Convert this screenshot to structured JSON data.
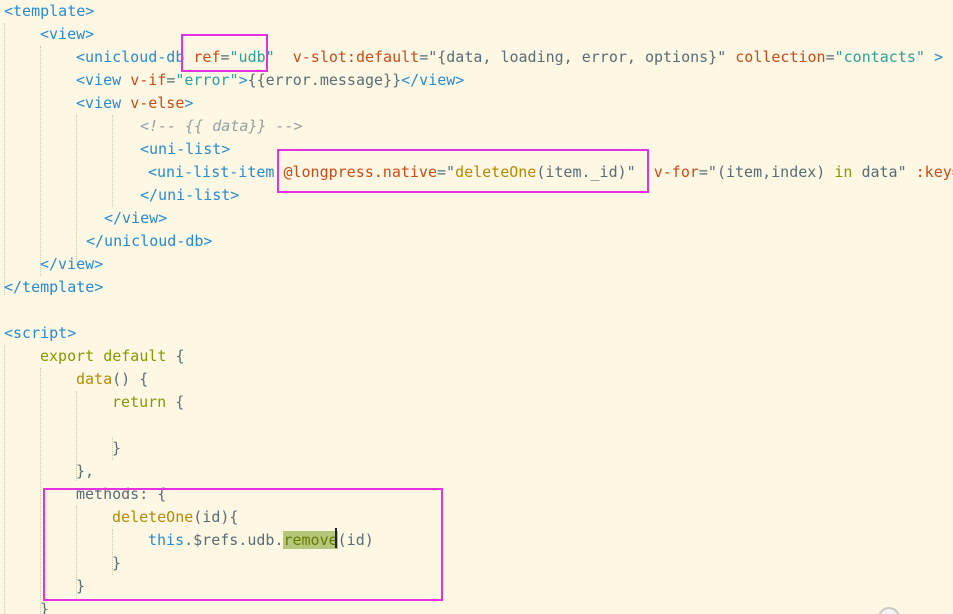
{
  "editor": {
    "language": "vue",
    "theme_colors": {
      "background": "#fdf7e4",
      "tag": "#268bd2",
      "attribute": "#cb4b16",
      "string": "#2aa198",
      "comment": "#93a1a1",
      "keyword": "#859900",
      "function": "#b58900",
      "annotation_box": "#e331e3"
    },
    "lines": [
      [
        {
          "t": "<template>",
          "c": "tag"
        }
      ],
      [
        {
          "t": "<view>",
          "c": "tag"
        }
      ],
      [
        {
          "t": "<unicloud-db",
          "c": "tag"
        },
        {
          "t": " ",
          "c": "text"
        },
        {
          "t": "ref",
          "c": "attr"
        },
        {
          "t": "=",
          "c": "text"
        },
        {
          "t": "\"udb\"",
          "c": "str"
        },
        {
          "t": "  ",
          "c": "text"
        },
        {
          "t": "v-slot:default",
          "c": "attr"
        },
        {
          "t": "=\"{data, loading, error, options}\"",
          "c": "text"
        },
        {
          "t": " ",
          "c": "text"
        },
        {
          "t": "collection",
          "c": "attr"
        },
        {
          "t": "=",
          "c": "text"
        },
        {
          "t": "\"contacts\"",
          "c": "str"
        },
        {
          "t": " ",
          "c": "text"
        },
        {
          "t": ">",
          "c": "tag"
        }
      ],
      [
        {
          "t": "<view",
          "c": "tag"
        },
        {
          "t": " ",
          "c": "text"
        },
        {
          "t": "v-if",
          "c": "attr"
        },
        {
          "t": "=",
          "c": "text"
        },
        {
          "t": "\"error\"",
          "c": "str"
        },
        {
          "t": ">",
          "c": "tag"
        },
        {
          "t": "{{error.message}}",
          "c": "text"
        },
        {
          "t": "</view>",
          "c": "tag"
        }
      ],
      [
        {
          "t": "<view",
          "c": "tag"
        },
        {
          "t": " ",
          "c": "text"
        },
        {
          "t": "v-else",
          "c": "attr"
        },
        {
          "t": ">",
          "c": "tag"
        }
      ],
      [
        {
          "t": "<!-- {{ data}} -->",
          "c": "comment"
        }
      ],
      [
        {
          "t": "<uni-list>",
          "c": "tag"
        }
      ],
      [
        {
          "t": "<uni-list-item",
          "c": "tag"
        },
        {
          "t": " ",
          "c": "text"
        },
        {
          "t": "@longpress.native",
          "c": "attr"
        },
        {
          "t": "=\"",
          "c": "text"
        },
        {
          "t": "deleteOne",
          "c": "fn"
        },
        {
          "t": "(item._id)\"",
          "c": "text"
        },
        {
          "t": "  ",
          "c": "text"
        },
        {
          "t": "v-for",
          "c": "attr"
        },
        {
          "t": "=\"(item,index) ",
          "c": "text"
        },
        {
          "t": "in",
          "c": "kw"
        },
        {
          "t": " data\"",
          "c": "text"
        },
        {
          "t": " ",
          "c": "text"
        },
        {
          "t": ":key=",
          "c": "attr"
        }
      ],
      [
        {
          "t": "</uni-list>",
          "c": "tag"
        }
      ],
      [
        {
          "t": "</view>",
          "c": "tag"
        }
      ],
      [
        {
          "t": "</unicloud-db>",
          "c": "tag"
        }
      ],
      [
        {
          "t": "</view>",
          "c": "tag"
        }
      ],
      [
        {
          "t": "</template>",
          "c": "tag"
        }
      ],
      [],
      [
        {
          "t": "<script>",
          "c": "tag"
        }
      ],
      [
        {
          "t": "export default",
          "c": "kw"
        },
        {
          "t": " {",
          "c": "text"
        }
      ],
      [
        {
          "t": "data",
          "c": "fn"
        },
        {
          "t": "() {",
          "c": "text"
        }
      ],
      [
        {
          "t": "return",
          "c": "kw"
        },
        {
          "t": " {",
          "c": "text"
        }
      ],
      [],
      [
        {
          "t": "}",
          "c": "text"
        }
      ],
      [
        {
          "t": "},",
          "c": "text"
        }
      ],
      [
        {
          "t": "methods: {",
          "c": "text"
        }
      ],
      [
        {
          "t": "deleteOne",
          "c": "fn"
        },
        {
          "t": "(id){",
          "c": "text"
        }
      ],
      [
        {
          "t": "this",
          "c": "this"
        },
        {
          "t": ".$refs.udb.",
          "c": "text"
        },
        {
          "t": "remove",
          "c": "hl"
        },
        {
          "t": "(id)",
          "c": "text"
        }
      ],
      [
        {
          "t": "}",
          "c": "text"
        }
      ],
      [
        {
          "t": "}",
          "c": "text"
        }
      ],
      [
        {
          "t": "}",
          "c": "text"
        }
      ]
    ]
  }
}
